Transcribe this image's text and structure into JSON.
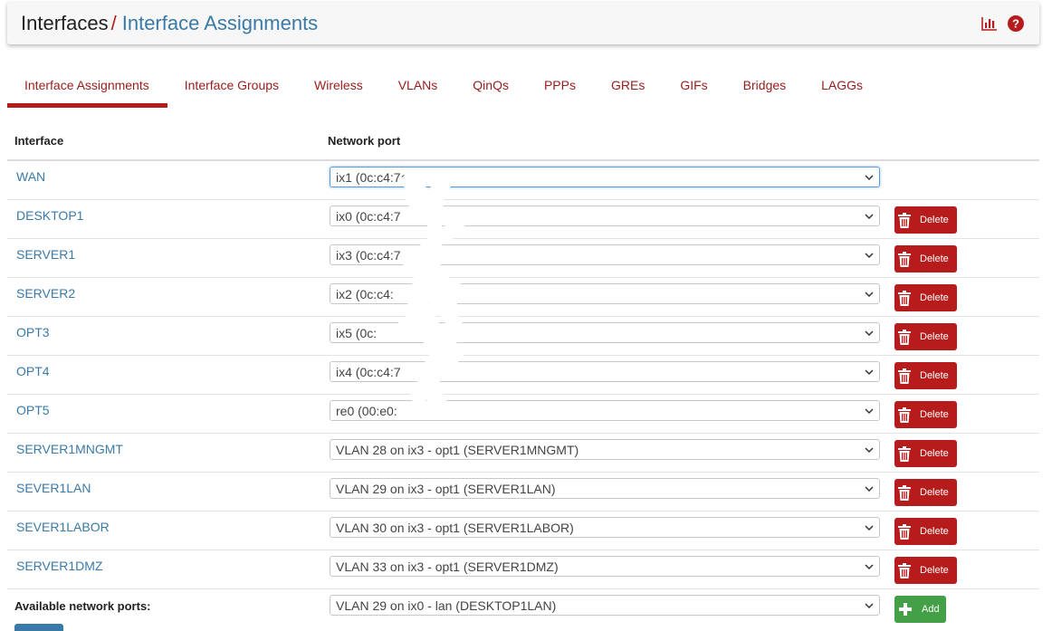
{
  "breadcrumb": {
    "root": "Interfaces",
    "separator": "/",
    "current": "Interface Assignments"
  },
  "header_icons": [
    "bar-chart-icon",
    "help-icon"
  ],
  "tabs": [
    {
      "label": "Interface Assignments",
      "active": true
    },
    {
      "label": "Interface Groups"
    },
    {
      "label": "Wireless"
    },
    {
      "label": "VLANs"
    },
    {
      "label": "QinQs"
    },
    {
      "label": "PPPs"
    },
    {
      "label": "GREs"
    },
    {
      "label": "GIFs"
    },
    {
      "label": "Bridges"
    },
    {
      "label": "LAGGs"
    }
  ],
  "table": {
    "headers": {
      "interface": "Interface",
      "network_port": "Network port"
    },
    "rows": [
      {
        "interface": "WAN",
        "port": "ix1 (0c:c4:7a"
      },
      {
        "interface": "DESKTOP1",
        "port": "ix0 (0c:c4:7",
        "action": "Delete"
      },
      {
        "interface": "SERVER1",
        "port": "ix3 (0c:c4:7",
        "action": "Delete"
      },
      {
        "interface": "SERVER2",
        "port": "ix2 (0c:c4:",
        "action": "Delete"
      },
      {
        "interface": "OPT3",
        "port": "ix5 (0c:",
        "action": "Delete"
      },
      {
        "interface": "OPT4",
        "port": "ix4 (0c:c4:7",
        "action": "Delete"
      },
      {
        "interface": "OPT5",
        "port": "re0 (00:e0:",
        "action": "Delete"
      },
      {
        "interface": "SERVER1MNGMT",
        "port": "VLAN 28 on ix3 - opt1 (SERVER1MNGMT)",
        "action": "Delete"
      },
      {
        "interface": "SEVER1LAN",
        "port": "VLAN 29 on ix3 - opt1 (SERVER1LAN)",
        "action": "Delete"
      },
      {
        "interface": "SEVER1LABOR",
        "port": "VLAN 30 on ix3 - opt1 (SERVER1LABOR)",
        "action": "Delete"
      },
      {
        "interface": "SERVER1DMZ",
        "port": "VLAN 33 on ix3 - opt1 (SERVER1DMZ)",
        "action": "Delete"
      }
    ],
    "available": {
      "label": "Available network ports:",
      "port": "VLAN 29 on ix0 - lan (DESKTOP1LAN)",
      "action": "Add"
    }
  },
  "colors": {
    "accent_red": "#b71c1c",
    "link_blue": "#3a7aa8",
    "add_green": "#43a047"
  }
}
